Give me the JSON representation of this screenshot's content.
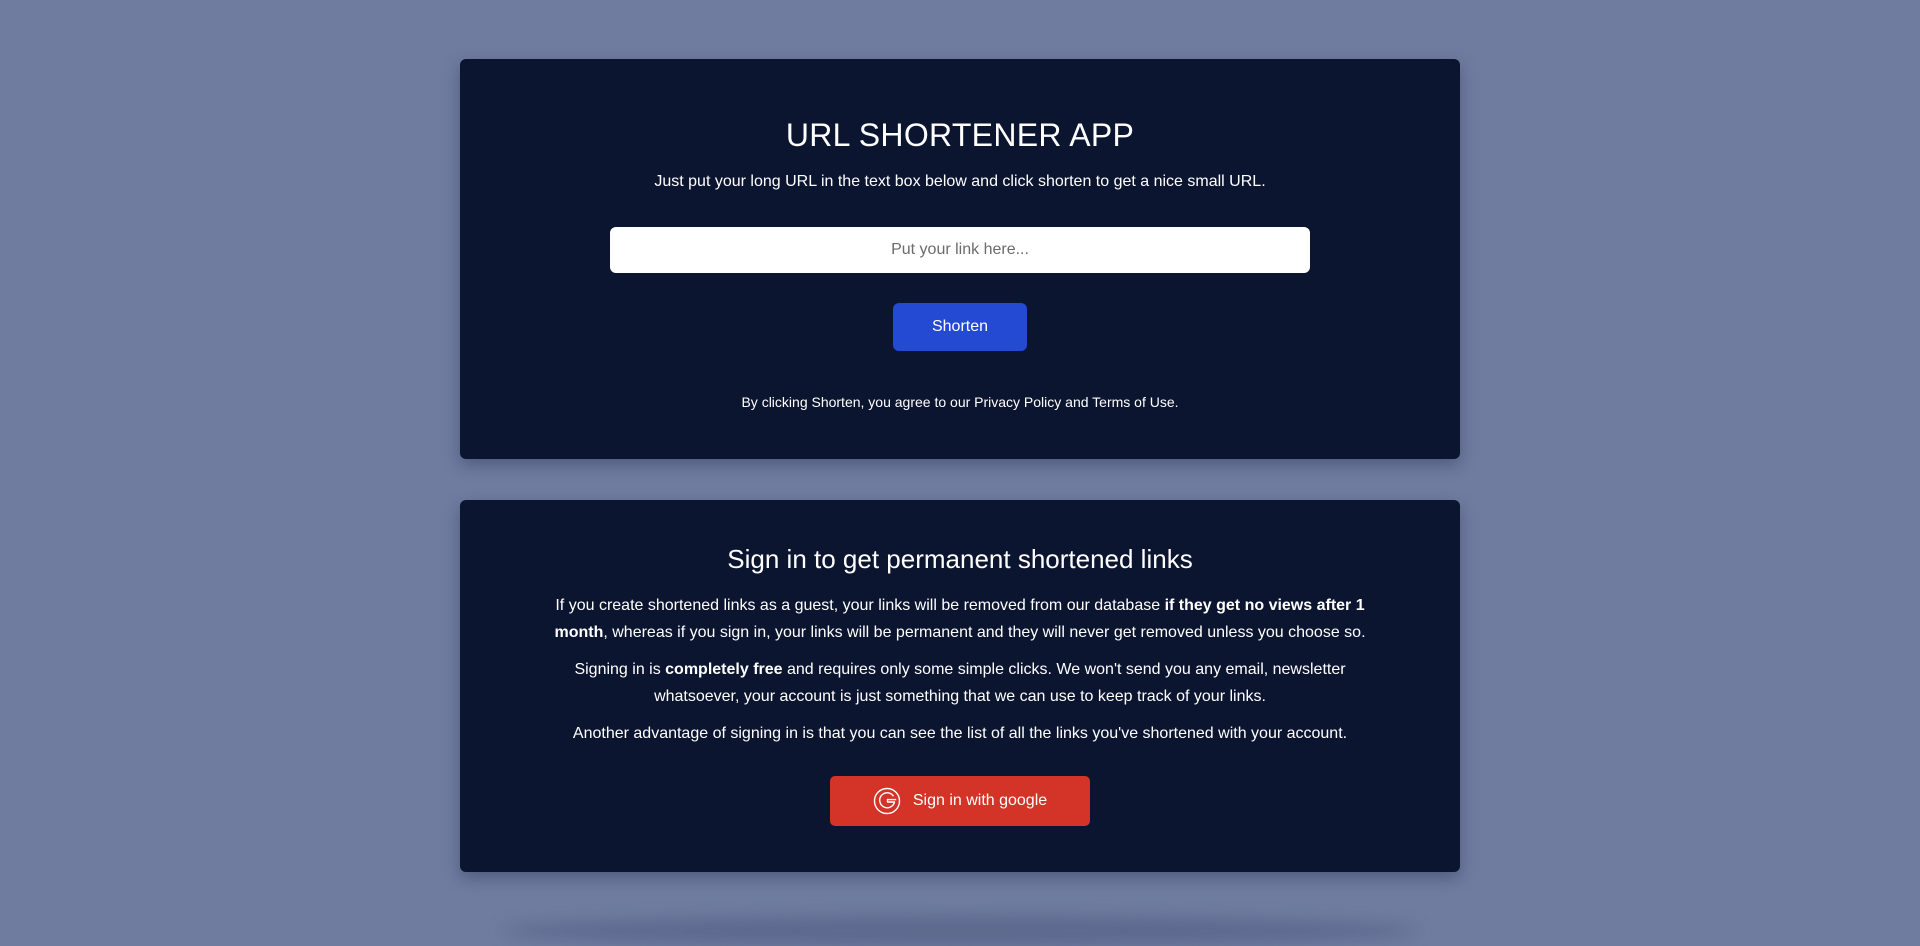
{
  "colors": {
    "page_background": "#6f7ca0",
    "card_background": "#0c1530",
    "shorten_button": "#2449d3",
    "google_button": "#d33427"
  },
  "shortener": {
    "title": "URL SHORTENER APP",
    "subtitle": "Just put your long URL in the text box below and click shorten to get a nice small URL.",
    "input_placeholder": "Put your link here...",
    "input_value": "",
    "shorten_label": "Shorten",
    "terms": "By clicking Shorten, you agree to our Privacy Policy and Terms of Use."
  },
  "signin": {
    "title": "Sign in to get permanent shortened links",
    "p1_a": "If you create shortened links as a guest, your links will be removed from our database ",
    "p1_bold": "if they get no views after 1 month",
    "p1_b": ", whereas if you sign in, your links will be permanent and they will never get removed unless you choose so.",
    "p2_a": "Signing in is ",
    "p2_bold": "completely free",
    "p2_b": " and requires only some simple clicks. We won't send you any email, newsletter whatsoever, your account is just something that we can use to keep track of your links.",
    "p3": "Another advantage of signing in is that you can see the list of all the links you've shortened with your account.",
    "google_label": "Sign in with google",
    "google_icon": "google-icon"
  }
}
